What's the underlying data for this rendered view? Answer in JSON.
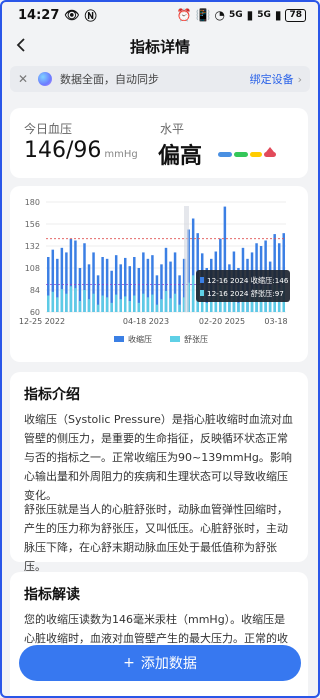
{
  "status_bar": {
    "time": "14:27",
    "signal": "5G",
    "battery": "78"
  },
  "header": {
    "title": "指标详情"
  },
  "sync_banner": {
    "message": "数据全面，自动同步",
    "bind_label": "绑定设备"
  },
  "summary": {
    "today_label": "今日血压",
    "value": "146/96",
    "unit": "mmHg",
    "level_label": "水平",
    "level": "偏高",
    "level_colors": [
      "#4a90e2",
      "#34c759",
      "#ffcc00",
      "#e24a5a"
    ]
  },
  "chart_data": {
    "type": "bar",
    "x_ticks": [
      "12-25 2022",
      "04-18 2023",
      "02-20 2025",
      "03-18"
    ],
    "y_ticks": [
      60,
      84,
      108,
      132,
      156,
      180
    ],
    "ylim": [
      60,
      180
    ],
    "reference_lines": [
      {
        "value": 140,
        "color": "#e05050"
      },
      {
        "value": 90,
        "color": "#8844cc"
      }
    ],
    "series": [
      {
        "name": "收缩压",
        "color": "#3b7fe4",
        "values": [
          120,
          128,
          118,
          130,
          125,
          140,
          138,
          108,
          135,
          112,
          125,
          100,
          120,
          118,
          105,
          122,
          112,
          119,
          110,
          120,
          108,
          125,
          118,
          122,
          100,
          112,
          130,
          115,
          125,
          100,
          118,
          150,
          162,
          146,
          124,
          108,
          118,
          126,
          140,
          175,
          112,
          126,
          108,
          130,
          118,
          125,
          135,
          132,
          138,
          115,
          145,
          135,
          146
        ]
      },
      {
        "name": "舒张压",
        "color": "#5fd0e6",
        "values": [
          78,
          82,
          76,
          85,
          80,
          88,
          86,
          72,
          84,
          74,
          80,
          68,
          78,
          76,
          70,
          79,
          74,
          77,
          72,
          78,
          70,
          80,
          76,
          79,
          68,
          74,
          83,
          75,
          80,
          68,
          76,
          92,
          100,
          96,
          80,
          70,
          76,
          82,
          90,
          98,
          74,
          82,
          70,
          84,
          76,
          80,
          86,
          85,
          88,
          75,
          92,
          86,
          97
        ]
      }
    ],
    "tooltip": {
      "lines": [
        {
          "label": "12-16 2024 收缩压:146",
          "color": "#3b7fe4"
        },
        {
          "label": "12-16 2024 舒张压:97",
          "color": "#5fd0e6"
        }
      ]
    }
  },
  "intro": {
    "title": "指标介绍",
    "p1": "收缩压（Systolic Pressure）是指心脏收缩时血流对血管壁的侧压力，是重要的生命指征，反映循环状态正常与否的指标之一。正常收缩压为90~139mmHg。影响心输出量和外周阻力的疾病和生理状态可以导致收缩压变化。",
    "p2": "舒张压就是当人的心脏舒张时，动脉血管弹性回缩时，产生的压力称为舒张压，又叫低压。心脏舒张时，主动脉压下降，在心舒末期动脉血压处于最低值称为舒张压。"
  },
  "interpretation": {
    "title": "指标解读",
    "p1": "您的收缩压读数为146毫米汞柱（mmHg）。收缩压是心脏收缩时，血液对血管壁产生的最大压力。正常的收缩压"
  },
  "add_button": {
    "label": "添加数据"
  }
}
